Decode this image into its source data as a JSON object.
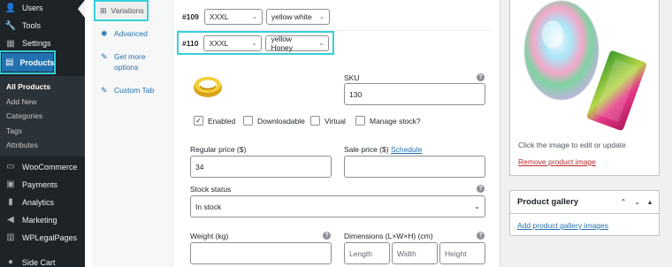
{
  "admin_menu": {
    "items_top": [
      {
        "label": "Users",
        "icon": "users-icon",
        "glyph": "👤"
      },
      {
        "label": "Tools",
        "icon": "wrench-icon",
        "glyph": "🔧"
      },
      {
        "label": "Settings",
        "icon": "settings-icon",
        "glyph": "▦"
      }
    ],
    "current": {
      "label": "Products",
      "icon": "archive-icon",
      "glyph": "▤"
    },
    "submenu": [
      "All Products",
      "Add New",
      "Categories",
      "Tags",
      "Attributes"
    ],
    "items_bottom": [
      {
        "label": "WooCommerce",
        "icon": "woocommerce-icon",
        "glyph": "▭"
      },
      {
        "label": "Payments",
        "icon": "payments-icon",
        "glyph": "▣"
      },
      {
        "label": "Analytics",
        "icon": "analytics-icon",
        "glyph": "▮"
      },
      {
        "label": "Marketing",
        "icon": "megaphone-icon",
        "glyph": "◀"
      },
      {
        "label": "WPLegalPages",
        "icon": "legalpages-icon",
        "glyph": "▥"
      },
      {
        "label": "Side Cart",
        "icon": "cart-icon",
        "glyph": "●"
      }
    ]
  },
  "tabs": [
    {
      "label": "Variations",
      "icon": "grid-icon",
      "glyph": "⊞"
    },
    {
      "label": "Advanced",
      "icon": "gear-icon",
      "glyph": "✱"
    },
    {
      "label": "Get more options",
      "icon": "plugin-icon",
      "glyph": "✎"
    },
    {
      "label": "Custom Tab",
      "icon": "wrench-icon",
      "glyph": "✎"
    }
  ],
  "variations": [
    {
      "num": "#109",
      "size": "XXXL",
      "color": "yellow white"
    },
    {
      "num": "#110",
      "size": "XXXL",
      "color": "yellow Honey"
    }
  ],
  "form": {
    "sku_label": "SKU",
    "sku_value": "130",
    "help": "?",
    "enabled": "Enabled",
    "downloadable": "Downloadable",
    "virtual": "Virtual",
    "manage_stock": "Manage stock?",
    "regular_price_label": "Regular price ($)",
    "regular_price": "34",
    "sale_price_label": "Sale price ($)",
    "schedule": "Schedule",
    "stock_status_label": "Stock status",
    "stock_status": "In stock",
    "weight_label": "Weight (kg)",
    "dimensions_label": "Dimensions (L×W×H) (cm)",
    "length": "Length",
    "width": "Width",
    "height": "Height"
  },
  "product_image": {
    "hint": "Click the image to edit or update",
    "remove": "Remove product image"
  },
  "gallery": {
    "title": "Product gallery",
    "add": "Add product gallery images"
  }
}
